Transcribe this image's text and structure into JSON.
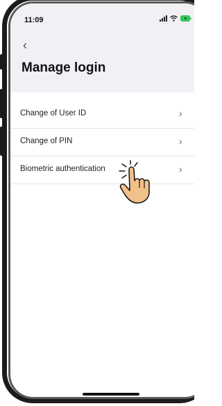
{
  "status_bar": {
    "time": "11:09"
  },
  "nav": {
    "back_icon": "chevron-left-icon",
    "back_glyph": "‹"
  },
  "page": {
    "title": "Manage login"
  },
  "menu": {
    "items": [
      {
        "label": "Change of User ID",
        "chevron": "›"
      },
      {
        "label": "Change of PIN",
        "chevron": "›"
      },
      {
        "label": "Biometric authentication",
        "chevron": "›"
      }
    ]
  },
  "colors": {
    "header_bg": "#f2eff5",
    "battery": "#34c759",
    "hand_skin": "#f2c089"
  }
}
